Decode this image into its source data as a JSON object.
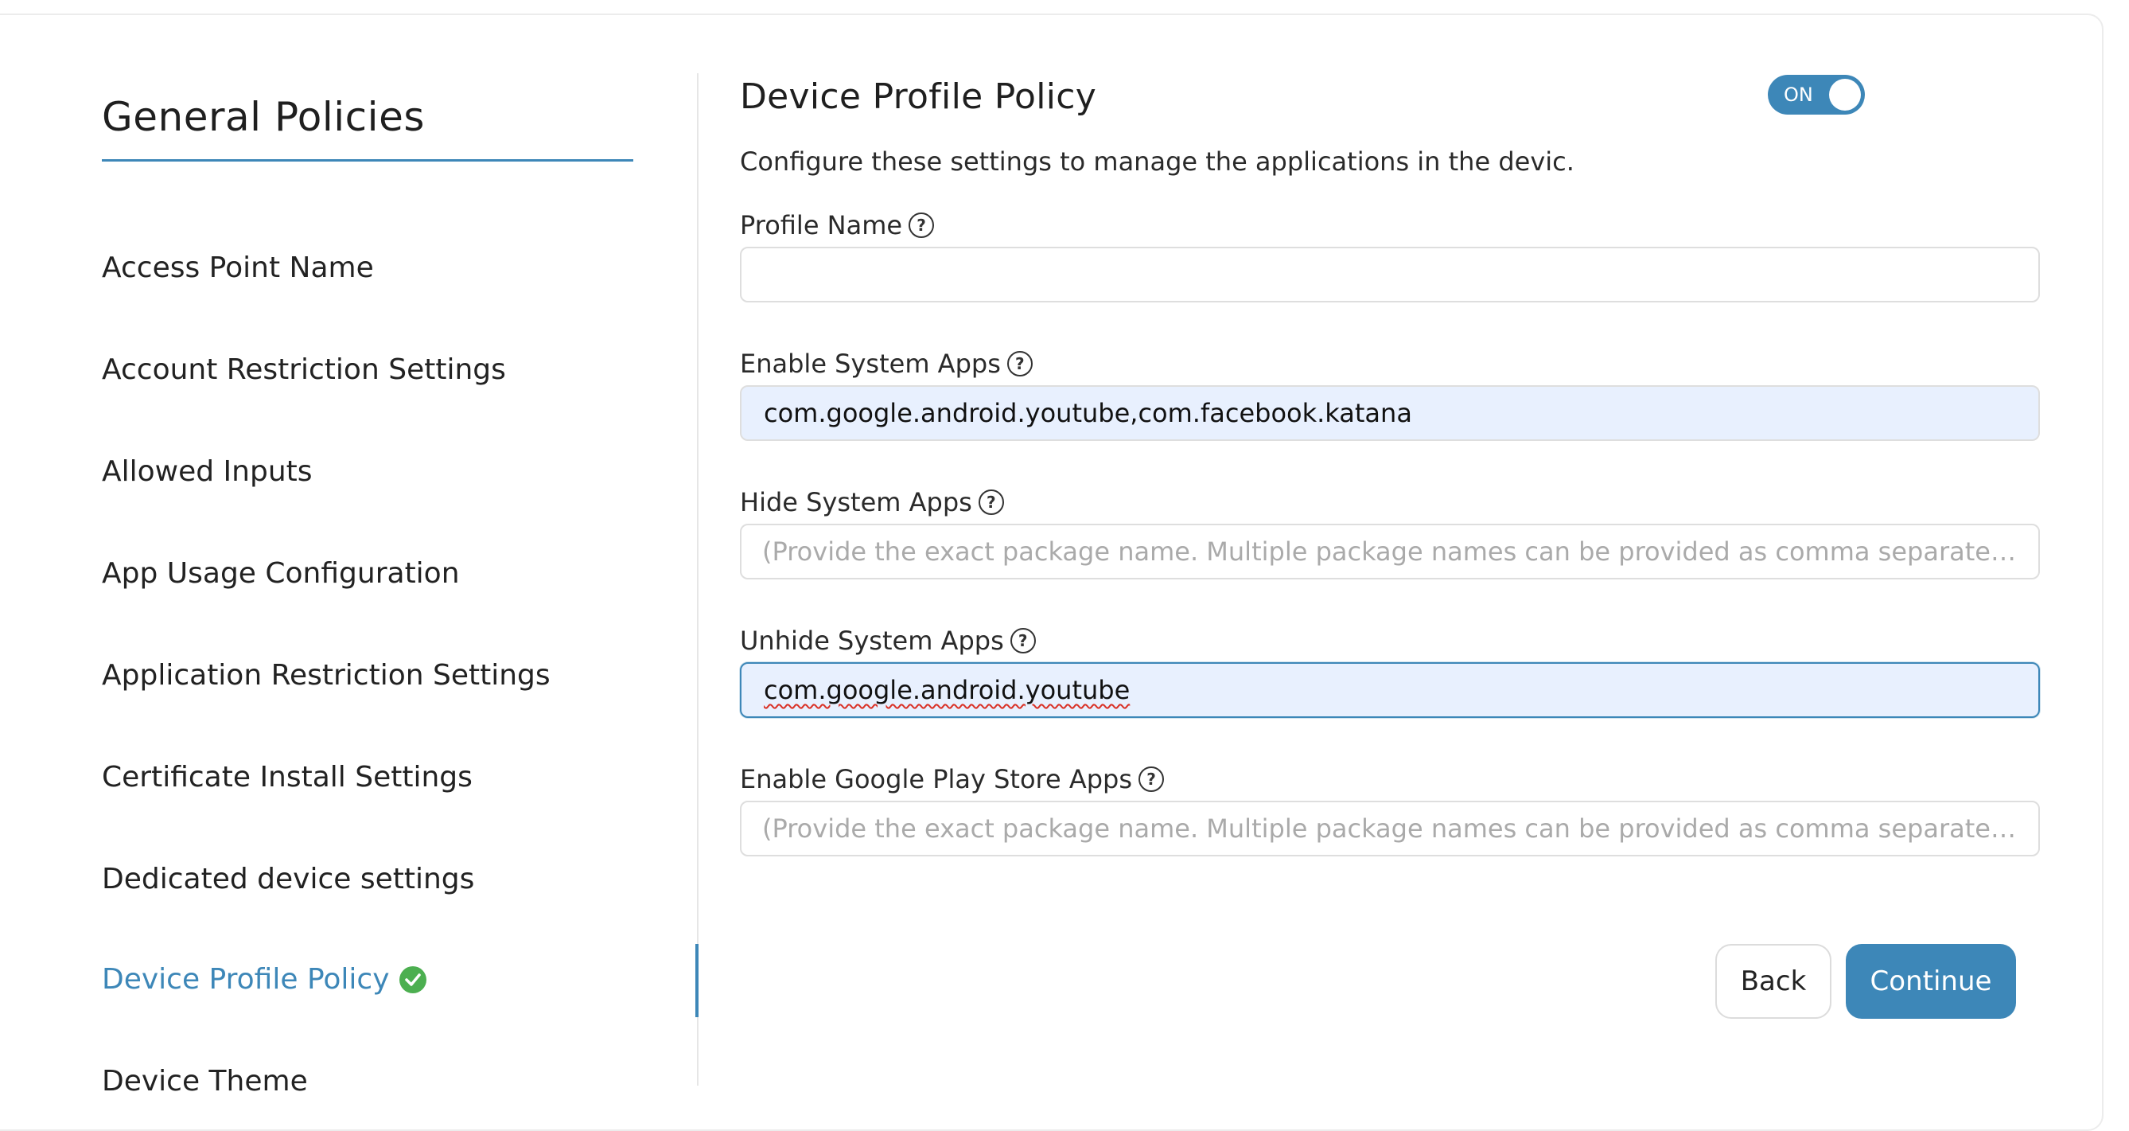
{
  "sidebar": {
    "title": "General Policies",
    "items": [
      {
        "label": "Access Point Name"
      },
      {
        "label": "Account Restriction Settings"
      },
      {
        "label": "Allowed Inputs"
      },
      {
        "label": "App Usage Configuration"
      },
      {
        "label": "Application Restriction Settings"
      },
      {
        "label": "Certificate Install Settings"
      },
      {
        "label": "Dedicated device settings"
      },
      {
        "label": "Device Profile Policy",
        "active": true,
        "status_icon": "check-circle-icon"
      },
      {
        "label": "Device Theme"
      }
    ]
  },
  "main": {
    "title": "Device Profile Policy",
    "toggle": {
      "label": "ON",
      "state": "on"
    },
    "description": "Configure these settings to manage the applications in the devic.",
    "fields": [
      {
        "label": "Profile Name",
        "value": "",
        "placeholder": ""
      },
      {
        "label": "Enable System Apps",
        "value": "com.google.android.youtube,com.facebook.katana",
        "placeholder": ""
      },
      {
        "label": "Hide System Apps",
        "value": "",
        "placeholder": "(Provide the exact package name. Multiple package names can be provided as comma separated values.)"
      },
      {
        "label": "Unhide System Apps",
        "value": "com.google.android.youtube",
        "placeholder": ""
      },
      {
        "label": "Enable Google Play Store Apps",
        "value": "",
        "placeholder": "(Provide the exact package name. Multiple package names can be provided as comma separated values.)"
      }
    ],
    "help_icon": "?",
    "buttons": {
      "back": "Back",
      "continue": "Continue"
    }
  },
  "colors": {
    "accent": "#3d87b8",
    "success": "#4caf50",
    "filled_input_bg": "#e8f0fe"
  }
}
